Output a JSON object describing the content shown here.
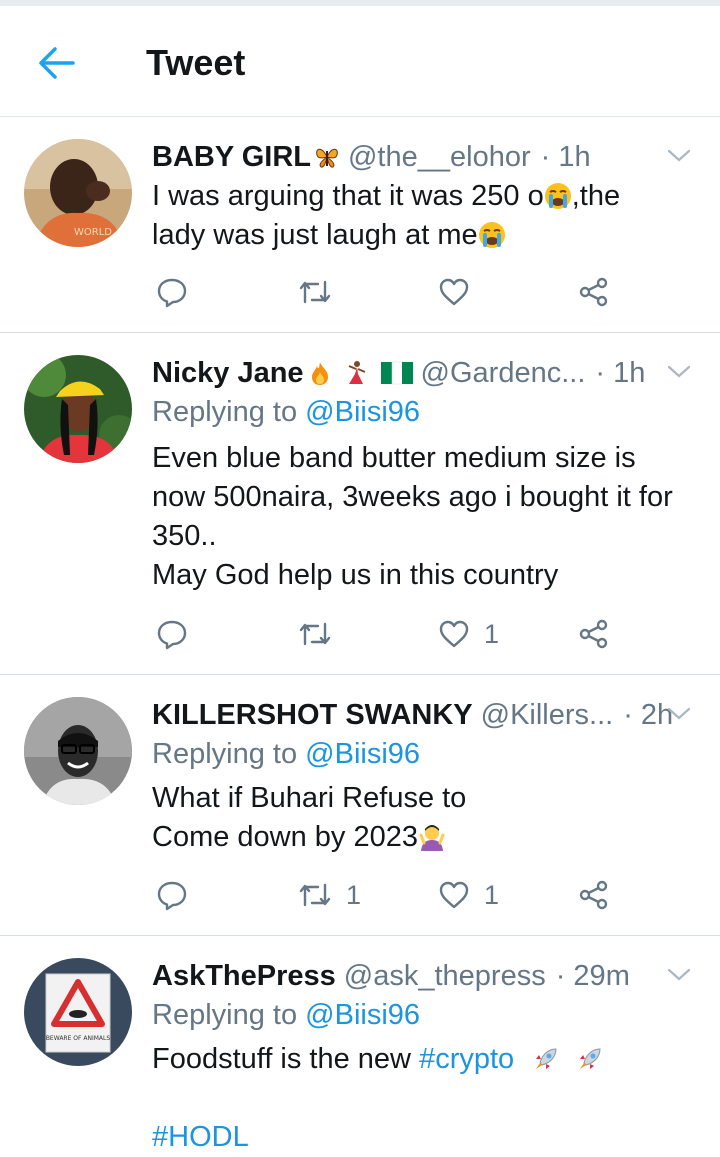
{
  "header": {
    "title": "Tweet"
  },
  "tweets": [
    {
      "name": "BABY GIRL",
      "handle": "@the__elohor",
      "time": "· 1h",
      "text_lines": [
        "I was arguing that it was 250 o",
        ",the",
        "lady was just laugh at me"
      ],
      "reply_count": "",
      "retweet_count": "",
      "like_count": ""
    },
    {
      "name": "Nicky Jane",
      "handle": "@Gardenc...",
      "time": "· 1h",
      "replying_prefix": "Replying to ",
      "replying_to": "@Biisi96",
      "text_lines": [
        "Even blue band butter medium size is",
        "now 500naira, 3weeks ago i bought it for",
        "350..",
        "May God help us in this country"
      ],
      "reply_count": "",
      "retweet_count": "",
      "like_count": "1"
    },
    {
      "name": "KILLERSHOT SWANKY",
      "handle": "@Killers...",
      "time": "· 2h",
      "replying_prefix": "Replying to ",
      "replying_to": "@Biisi96",
      "text_lines": [
        "What if Buhari Refuse to",
        "Come down by 2023"
      ],
      "reply_count": "",
      "retweet_count": "1",
      "like_count": "1"
    },
    {
      "name": "AskThePress",
      "handle": "@ask_thepress",
      "time": "· 29m",
      "replying_prefix": "Replying to ",
      "replying_to": "@Biisi96",
      "text_prefix": "Foodstuff is the new ",
      "hashtag1": "#crypto",
      "hashtag2": "#HODL",
      "avatar_sign_text": "BEWARE OF ANIMALS"
    }
  ],
  "colors": {
    "accent": "#1b95e0",
    "secondary": "#657786",
    "text": "#14171a"
  }
}
